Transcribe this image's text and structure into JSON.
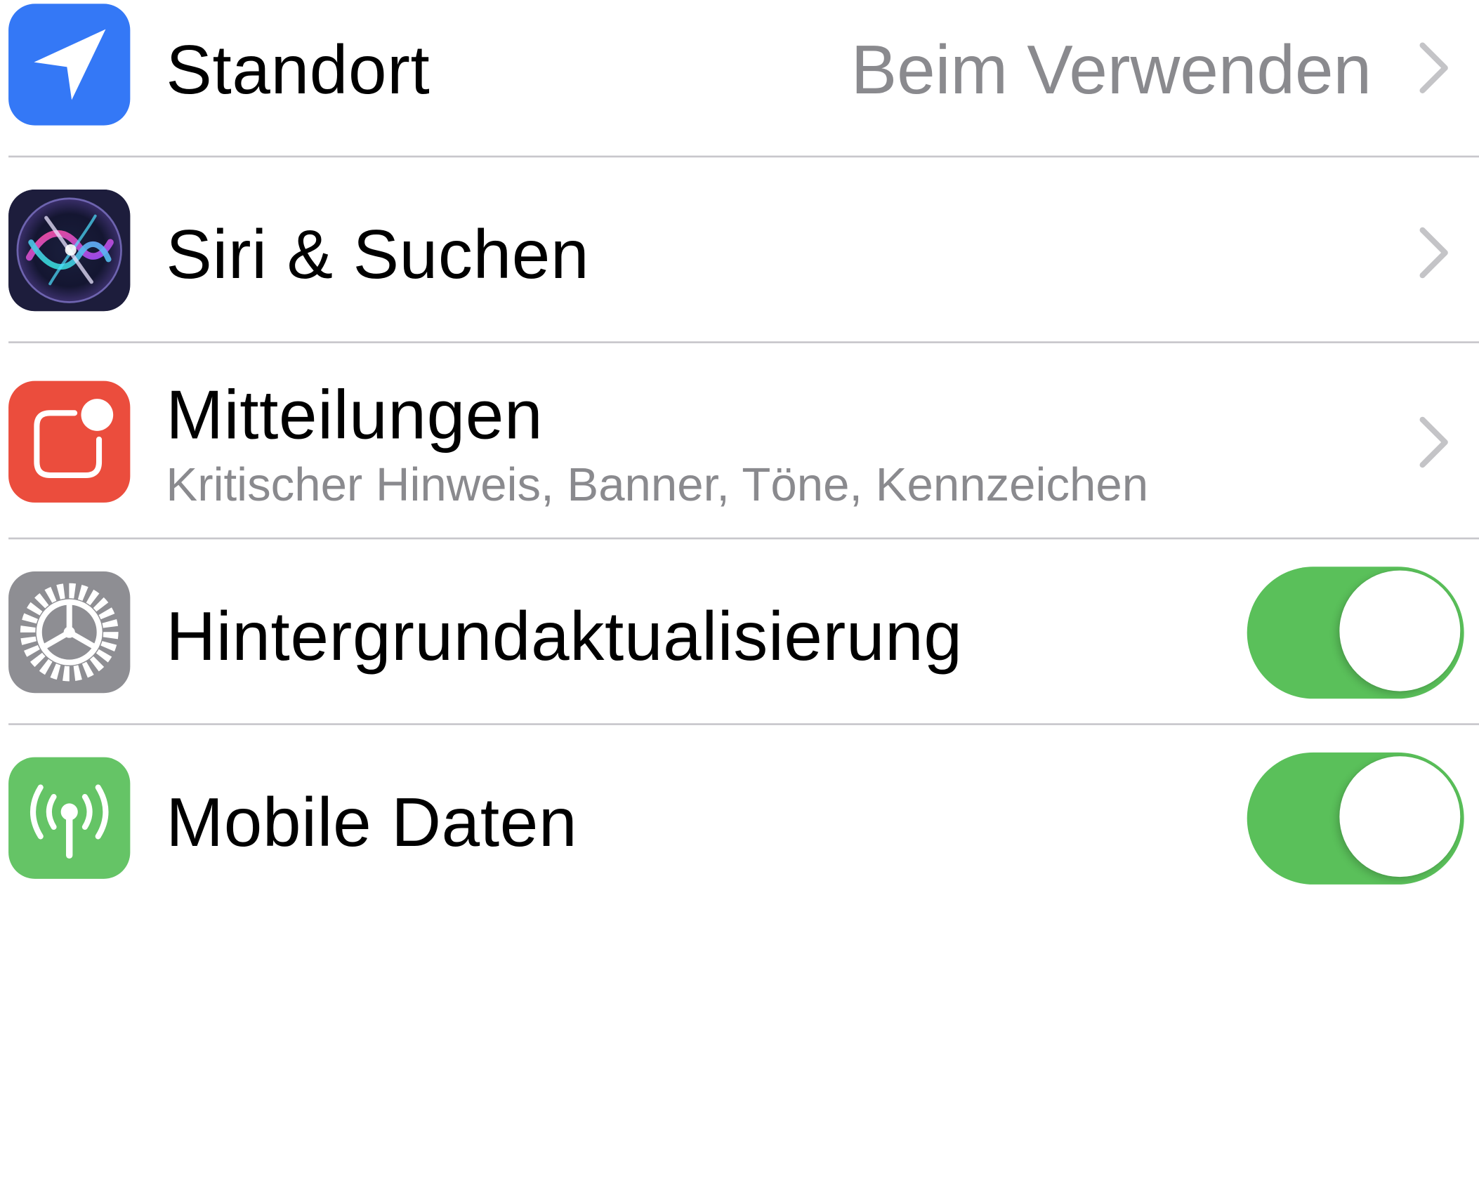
{
  "rows": [
    {
      "id": "location",
      "label": "Standort",
      "value": "Beim Verwenden",
      "icon": "location-arrow-icon",
      "icon_bg": "#3478f6",
      "accessory": "chevron"
    },
    {
      "id": "siri",
      "label": "Siri & Suchen",
      "icon": "siri-icon",
      "icon_bg": "#1c1c3a",
      "accessory": "chevron"
    },
    {
      "id": "notifications",
      "label": "Mitteilungen",
      "subtitle": "Kritischer Hinweis, Banner, Töne, Kennzeichen",
      "icon": "notification-icon",
      "icon_bg": "#eb4d3d",
      "accessory": "chevron"
    },
    {
      "id": "background-refresh",
      "label": "Hintergrundaktualisierung",
      "icon": "gear-icon",
      "icon_bg": "#8e8e93",
      "accessory": "toggle",
      "toggle_on": true
    },
    {
      "id": "mobile-data",
      "label": "Mobile Daten",
      "icon": "antenna-icon",
      "icon_bg": "#65c466",
      "accessory": "toggle",
      "toggle_on": true
    }
  ],
  "colors": {
    "toggle_on": "#5ac05a",
    "separator": "#c8c7cc",
    "secondary_text": "#8a8a8e",
    "chevron": "#c4c4c7"
  }
}
